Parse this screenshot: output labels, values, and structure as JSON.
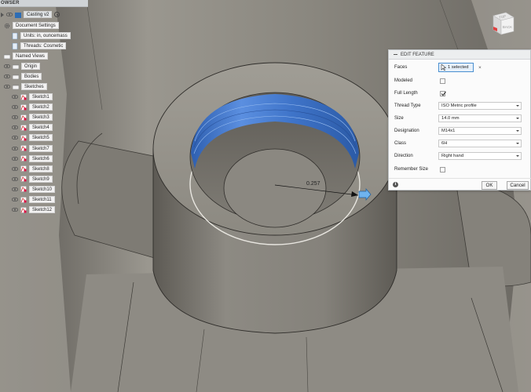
{
  "browser": {
    "title": "OWSER",
    "document": {
      "name": "Casting v2"
    },
    "document_settings": {
      "label": "Document Settings"
    },
    "units": {
      "label": "Units: in, ouncemass"
    },
    "threads": {
      "label": "Threads: Cosmetic"
    },
    "named_views": {
      "label": "Named Views"
    },
    "origin": {
      "label": "Origin"
    },
    "bodies": {
      "label": "Bodies"
    },
    "sketches": {
      "label": "Sketches",
      "items": [
        {
          "label": "Sketch1"
        },
        {
          "label": "Sketch2"
        },
        {
          "label": "Sketch3"
        },
        {
          "label": "Sketch4"
        },
        {
          "label": "Sketch5"
        },
        {
          "label": "Sketch7"
        },
        {
          "label": "Sketch6"
        },
        {
          "label": "Sketch8"
        },
        {
          "label": "Sketch9"
        },
        {
          "label": "Sketch10"
        },
        {
          "label": "Sketch11"
        },
        {
          "label": "Sketch12"
        }
      ]
    }
  },
  "dialog": {
    "title": "EDIT FEATURE",
    "fields": {
      "faces": {
        "label": "Faces",
        "value": "1 selected",
        "clear": "×"
      },
      "modeled": {
        "label": "Modeled",
        "checked": false
      },
      "full_length": {
        "label": "Full Length",
        "checked": true
      },
      "thread_type": {
        "label": "Thread Type",
        "value": "ISO Metric profile"
      },
      "size": {
        "label": "Size",
        "value": "14.0 mm"
      },
      "designation": {
        "label": "Designation",
        "value": "M14x1"
      },
      "class": {
        "label": "Class",
        "value": "6H"
      },
      "direction": {
        "label": "Direction",
        "value": "Right hand"
      },
      "remember_size": {
        "label": "Remember Size",
        "checked": false
      }
    },
    "info": "i",
    "ok_label": "OK",
    "cancel_label": "Cancel"
  },
  "viewport": {
    "dimension": "0.257"
  },
  "view_cube": {
    "top": "TOP",
    "back": "BACK"
  },
  "colors": {
    "accent": "#4a8fd0",
    "thread_face": "#4f86d8",
    "body": "#8a877f"
  }
}
